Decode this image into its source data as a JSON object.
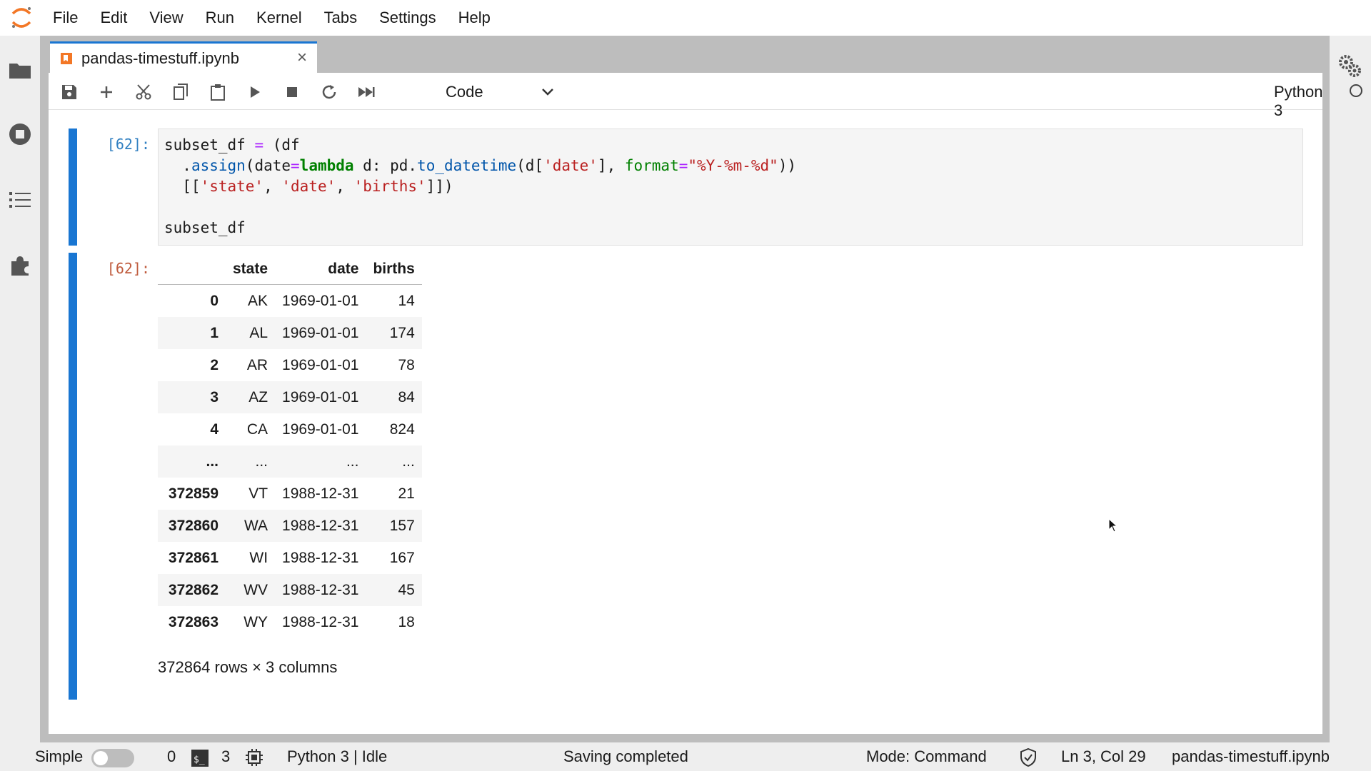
{
  "menu": {
    "items": [
      "File",
      "Edit",
      "View",
      "Run",
      "Kernel",
      "Tabs",
      "Settings",
      "Help"
    ]
  },
  "tab": {
    "title": "pandas-timestuff.ipynb",
    "close": "×"
  },
  "toolbar": {
    "cell_type": "Code",
    "kernel_name": "Python 3"
  },
  "cells": {
    "input_prompt": "[62]:",
    "output_prompt": "[62]:",
    "code_lines": [
      "subset_df = (df",
      "  .assign(date=lambda d: pd.to_datetime(d['date'], format=\"%Y-%m-%d\"))",
      "  [['state', 'date', 'births']])",
      "",
      "subset_df"
    ]
  },
  "table": {
    "columns": [
      "",
      "state",
      "date",
      "births"
    ],
    "rows": [
      [
        "0",
        "AK",
        "1969-01-01",
        "14"
      ],
      [
        "1",
        "AL",
        "1969-01-01",
        "174"
      ],
      [
        "2",
        "AR",
        "1969-01-01",
        "78"
      ],
      [
        "3",
        "AZ",
        "1969-01-01",
        "84"
      ],
      [
        "4",
        "CA",
        "1969-01-01",
        "824"
      ],
      [
        "...",
        "...",
        "...",
        "..."
      ],
      [
        "372859",
        "VT",
        "1988-12-31",
        "21"
      ],
      [
        "372860",
        "WA",
        "1988-12-31",
        "157"
      ],
      [
        "372861",
        "WI",
        "1988-12-31",
        "167"
      ],
      [
        "372862",
        "WV",
        "1988-12-31",
        "45"
      ],
      [
        "372863",
        "WY",
        "1988-12-31",
        "18"
      ]
    ],
    "shape": "372864 rows × 3 columns"
  },
  "statusbar": {
    "mode_label": "Simple",
    "terminals_count": "0",
    "kernels_count": "3",
    "kernel_status": "Python 3 | Idle",
    "message": "Saving completed",
    "mode": "Mode: Command",
    "position": "Ln 3, Col 29",
    "filename": "pandas-timestuff.ipynb"
  },
  "colors": {
    "accent": "#1976d2",
    "in_prompt": "#307fc1",
    "out_prompt": "#bf5b3d"
  }
}
